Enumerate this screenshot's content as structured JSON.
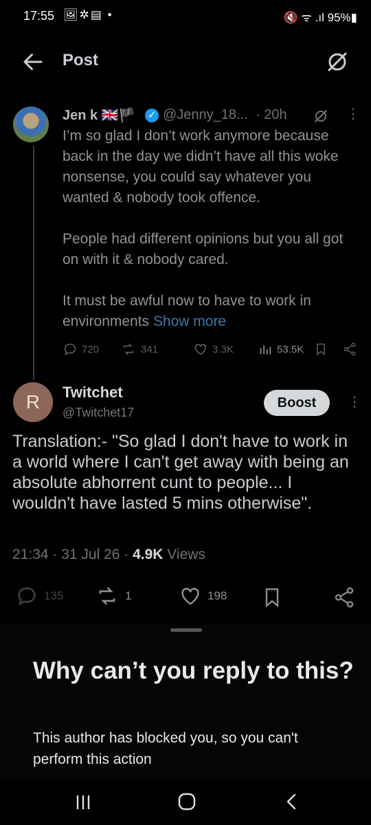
{
  "status_bar": {
    "time": "17:55",
    "left_icons": "🖼✲▤ •",
    "right_icons": "🔇 ᯤ .ıl 95%▮"
  },
  "header": {
    "title": "Post"
  },
  "parent_tweet": {
    "name": "Jen k 🇬🇧🏴",
    "handle": "@Jenny_18...",
    "time": "· 20h",
    "paragraphs": [
      "I’m so glad I don’t work anymore because back in the day we didn’t have all this woke nonsense, you could say whatever you wanted & nobody took offence.",
      "People had different opinions but you all got on with it & nobody cared.",
      "It must be awful now to have to work in environments"
    ],
    "show_more": "Show more",
    "stats": {
      "replies": "720",
      "reposts": "341",
      "likes": "3.3K",
      "views": "53.5K"
    }
  },
  "reply_tweet": {
    "avatar_letter": "R",
    "name": "Twitchet",
    "handle": "@Twitchet17",
    "boost_label": "Boost",
    "body": "Translation:- \"So glad I don't have to work in a world where I can't get away with being an absolute abhorrent cunt to people... I wouldn't have lasted 5 mins otherwise\".",
    "time": "21:34 · 31 Jul 26 · ",
    "views_count": "4.9K",
    "views_label": " Views",
    "stats": {
      "replies": "135",
      "reposts": "1",
      "likes": "198"
    }
  },
  "sheet": {
    "title": "Why can’t you reply to this?",
    "text": "This author has blocked you, so you can't perform this action"
  },
  "colors": {
    "accent": "#1d9bf0",
    "show_more": "#3d79aa",
    "avatar_r": "#8c6659"
  }
}
